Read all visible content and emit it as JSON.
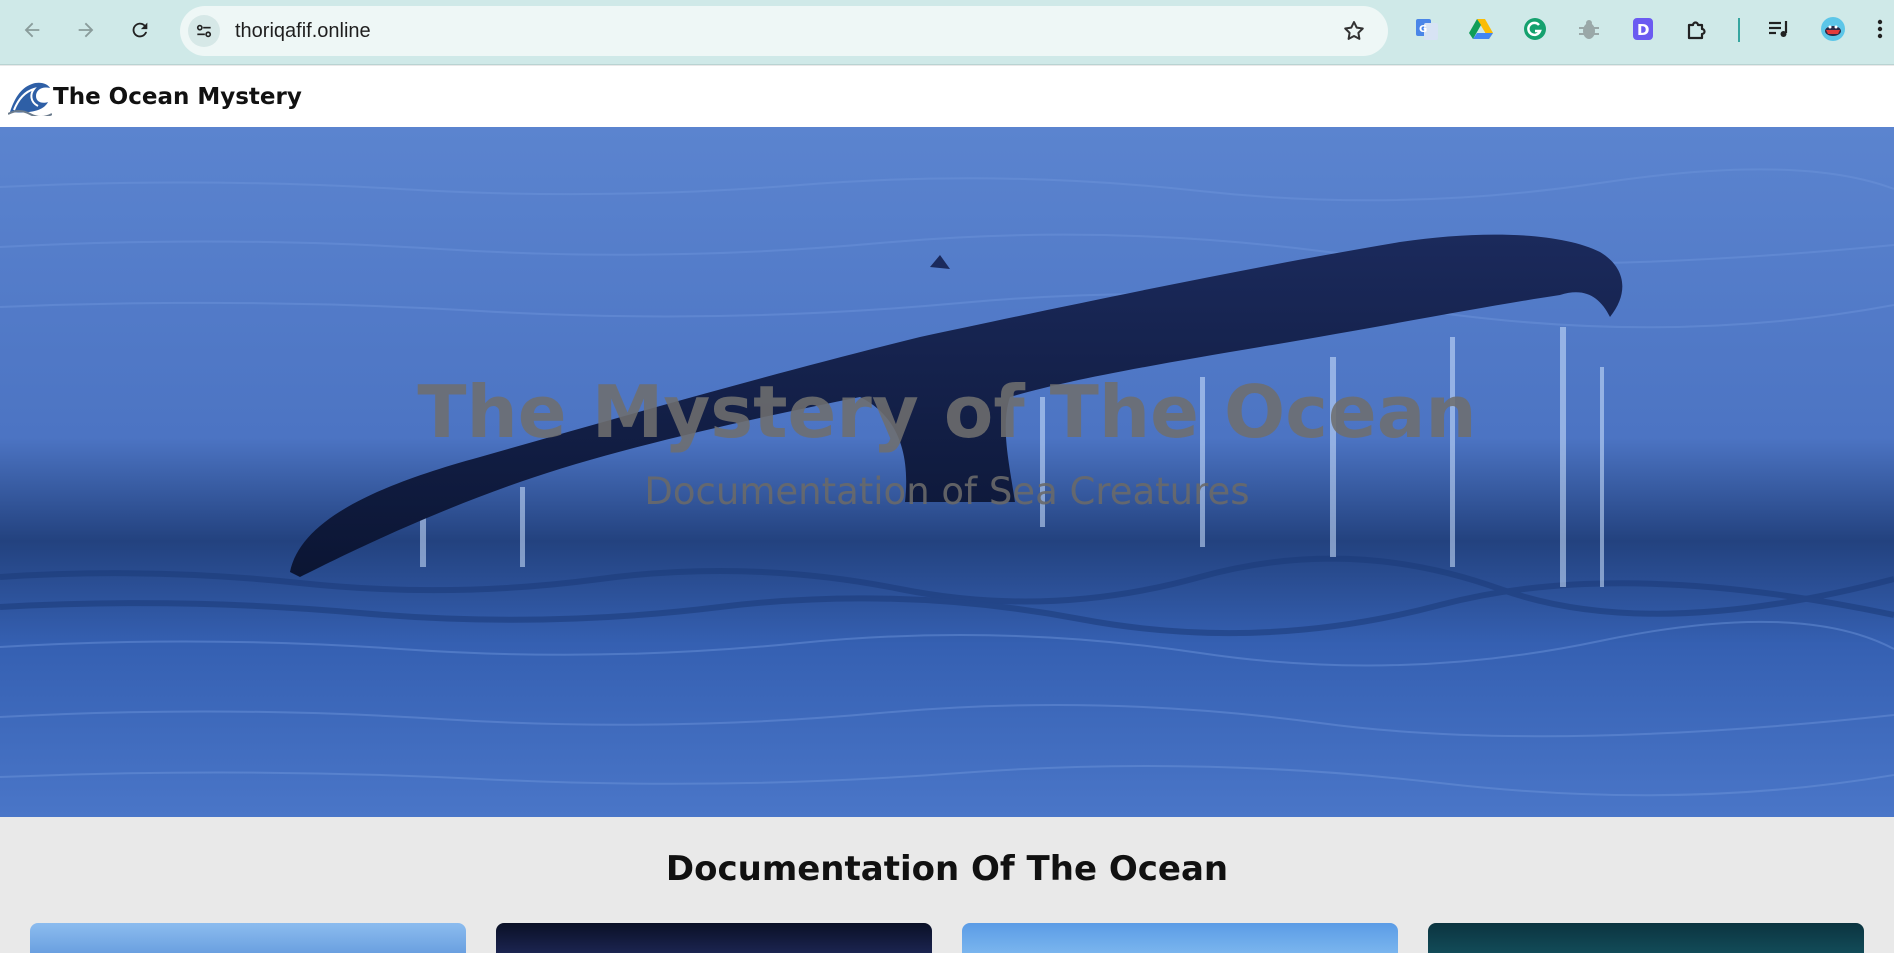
{
  "browser": {
    "url": "thoriqafif.online",
    "icons": [
      "back-arrow-icon",
      "forward-arrow-icon",
      "reload-icon",
      "site-info-icon",
      "bookmark-star-icon",
      "google-translate-icon",
      "google-drive-icon",
      "grammarly-icon",
      "bug-extension-icon",
      "d-extension-icon",
      "extensions-puzzle-icon",
      "media-queue-icon",
      "profile-avatar-icon",
      "menu-kebab-icon"
    ]
  },
  "site": {
    "brand": "The Ocean Mystery",
    "logo_icon": "wave-logo-icon"
  },
  "hero": {
    "title": "The Mystery of The Ocean",
    "subtitle": "Documentation of Sea Creatures"
  },
  "documentation": {
    "heading": "Documentation Of The Ocean",
    "cards": [
      {
        "name": "card-1",
        "color": "#7fb0e8"
      },
      {
        "name": "card-2",
        "color": "#0f1630"
      },
      {
        "name": "card-3",
        "color": "#6aa6e6"
      },
      {
        "name": "card-4",
        "color": "#0d3b46"
      }
    ]
  },
  "colors": {
    "chrome": "#cfe9e8",
    "omnibox": "#eef7f6",
    "accent": "#37a6a0",
    "hero_water": "#3f67b7"
  }
}
